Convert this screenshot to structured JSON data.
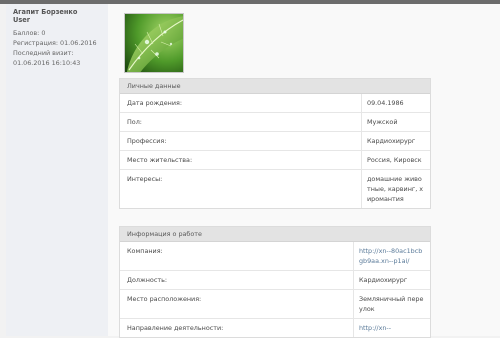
{
  "user": {
    "name": "Агапит Борзенко",
    "role": "User",
    "points": "Баллов: 0",
    "registration": "Регистрация: 01.06.2016",
    "last_visit": "Последний визит: 01.06.2016 16:10:43"
  },
  "personal": {
    "title": "Личные данные",
    "rows": [
      {
        "label": "Дата рождения:",
        "value": "09.04.1986"
      },
      {
        "label": "Пол:",
        "value": "Мужской"
      },
      {
        "label": "Профессия:",
        "value": "Кардиохирург"
      },
      {
        "label": "Место жительства:",
        "value": "Россия, Кировск"
      },
      {
        "label": "Интересы:",
        "value": "домашние животные, карвинг, хиромантия"
      }
    ]
  },
  "work": {
    "title": "Информация о работе",
    "rows": [
      {
        "label": "Компания:",
        "value": "http://xn--80ac1bcbgb9aa.xn--p1ai/"
      },
      {
        "label": "Должность:",
        "value": "Кардиохирург"
      },
      {
        "label": "Место расположения:",
        "value": "Земляничный переулок"
      },
      {
        "label": "Направление деятельности:",
        "value": "http://xn--"
      }
    ]
  },
  "avatar_icon": "leaf-photo"
}
